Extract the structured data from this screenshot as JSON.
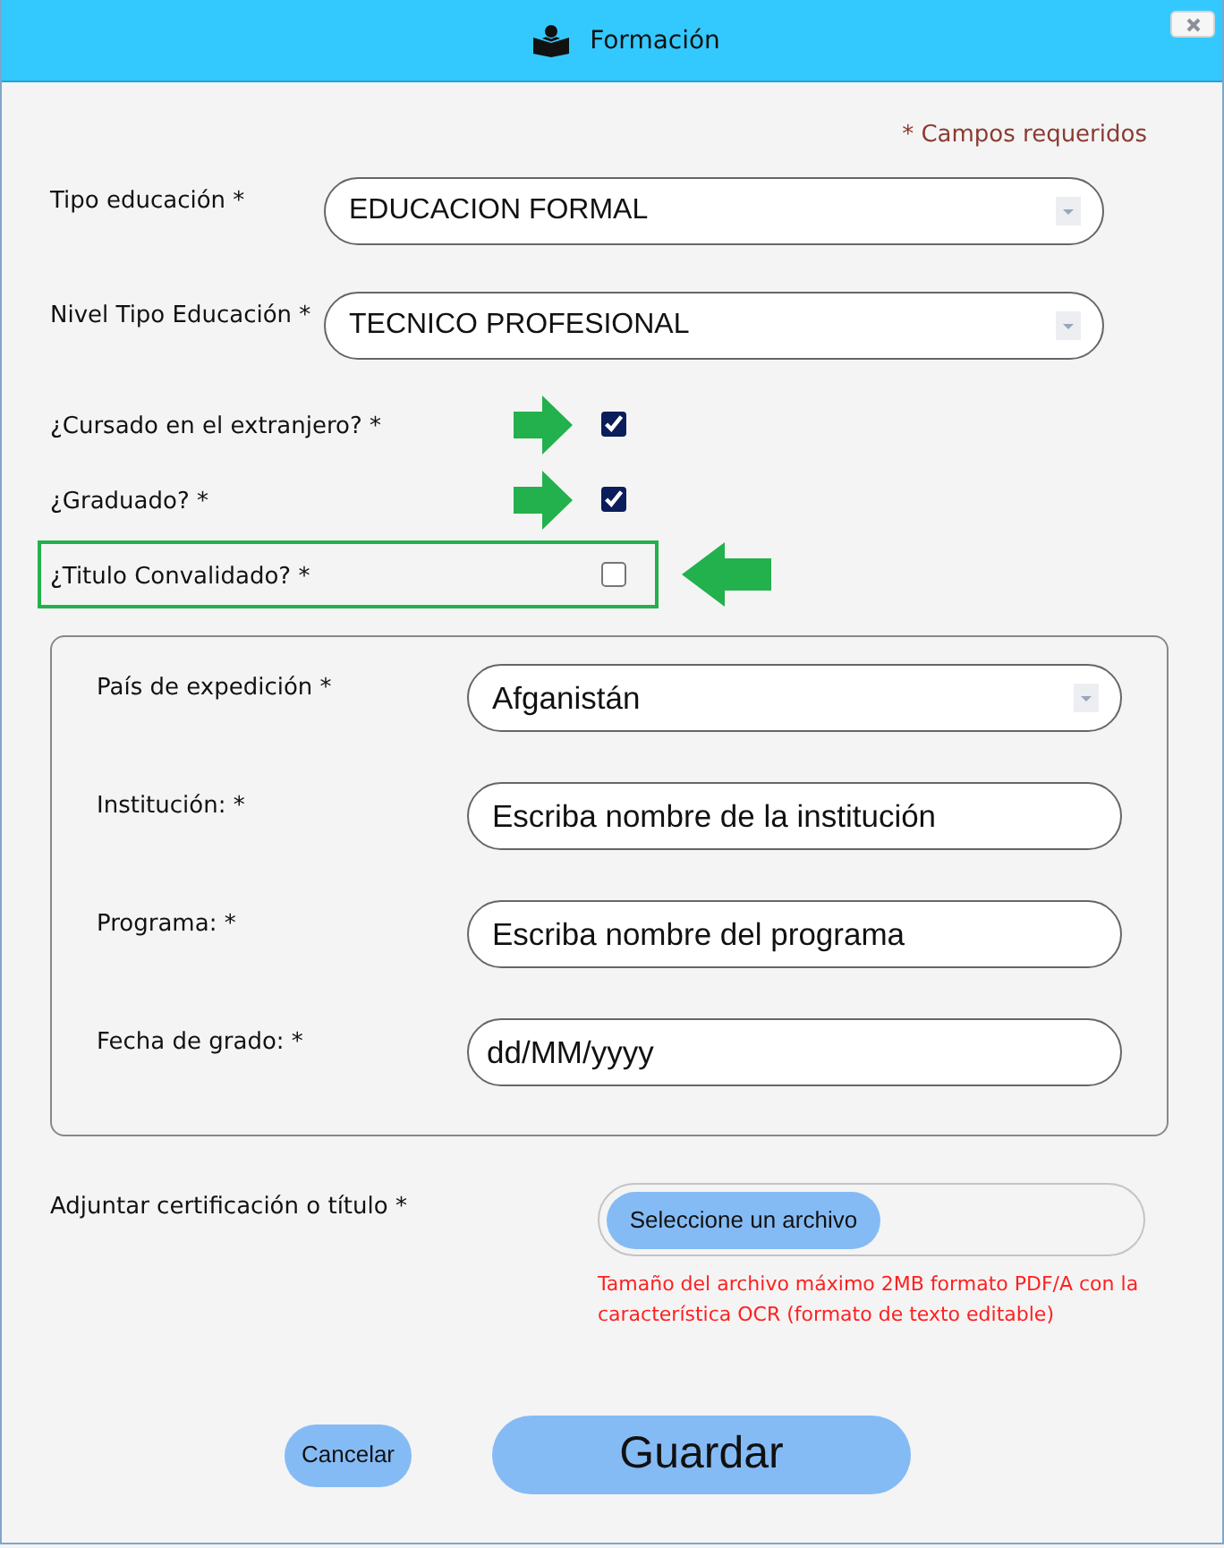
{
  "window": {
    "title": "Formación"
  },
  "required_note": "* Campos requeridos",
  "fields": [
    {
      "kind": "select",
      "label": "Tipo educación *",
      "value": "EDUCACION FORMAL"
    },
    {
      "kind": "select",
      "label": "Nivel Tipo Educación *",
      "value": "TECNICO PROFESIONAL"
    }
  ],
  "questions": [
    {
      "label": "¿Cursado en el extranjero? *",
      "checked": true,
      "pointed": true,
      "highlighted": false
    },
    {
      "label": "¿Graduado? *",
      "checked": true,
      "pointed": true,
      "highlighted": false
    },
    {
      "label": "¿Titulo Convalidado? *",
      "checked": false,
      "pointed": true,
      "highlighted": true
    }
  ],
  "foreign_details": {
    "fields": [
      {
        "kind": "select",
        "label": "País de expedición *",
        "value": "Afganistán"
      },
      {
        "kind": "text",
        "label": "Institución: *",
        "placeholder": "Escriba nombre de la institución"
      },
      {
        "kind": "text",
        "label": "Programa: *",
        "placeholder": "Escriba nombre del programa"
      },
      {
        "kind": "date",
        "label": "Fecha de grado: *",
        "placeholder": "dd/MM/yyyy"
      }
    ]
  },
  "attachment": {
    "label": "Adjuntar certificación o título *",
    "button": "Seleccione un archivo",
    "hint": "Tamaño del archivo máximo 2MB formato PDF/A con la característica OCR (formato de texto editable)"
  },
  "buttons": [
    {
      "kind": "secondary",
      "label": "Cancelar"
    },
    {
      "kind": "primary",
      "label": "Guardar"
    }
  ]
}
